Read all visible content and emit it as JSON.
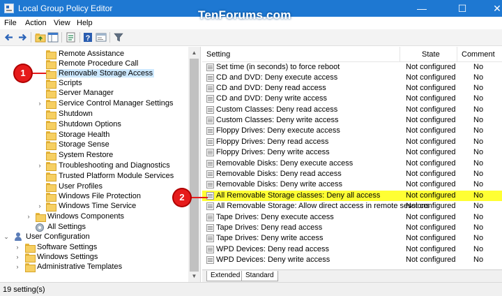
{
  "window": {
    "title": "Local Group Policy Editor",
    "watermark": "TenForums.com",
    "min_glyph": "—",
    "max_glyph": "☐",
    "close_glyph": "✕"
  },
  "menu": [
    "File",
    "Action",
    "View",
    "Help"
  ],
  "toolbar": {
    "icons": [
      "back-icon",
      "forward-icon",
      "up-folder-icon",
      "show-hide-tree-icon",
      "export-list-icon",
      "help-icon",
      "properties-icon",
      "filter-icon"
    ]
  },
  "tree": {
    "items": [
      {
        "label": "Remote Assistance",
        "expander": ""
      },
      {
        "label": "Remote Procedure Call",
        "expander": ""
      },
      {
        "label": "Removable Storage Access",
        "expander": "",
        "selected": true
      },
      {
        "label": "Scripts",
        "expander": ""
      },
      {
        "label": "Server Manager",
        "expander": ""
      },
      {
        "label": "Service Control Manager Settings",
        "expander": "›"
      },
      {
        "label": "Shutdown",
        "expander": ""
      },
      {
        "label": "Shutdown Options",
        "expander": ""
      },
      {
        "label": "Storage Health",
        "expander": ""
      },
      {
        "label": "Storage Sense",
        "expander": ""
      },
      {
        "label": "System Restore",
        "expander": ""
      },
      {
        "label": "Troubleshooting and Diagnostics",
        "expander": "›"
      },
      {
        "label": "Trusted Platform Module Services",
        "expander": ""
      },
      {
        "label": "User Profiles",
        "expander": ""
      },
      {
        "label": "Windows File Protection",
        "expander": ""
      },
      {
        "label": "Windows Time Service",
        "expander": "›"
      },
      {
        "label": "Windows Components",
        "expander": "›"
      },
      {
        "label": "All Settings",
        "expander": ""
      },
      {
        "label": "User Configuration",
        "expander": "⌄"
      },
      {
        "label": "Software Settings",
        "expander": "›"
      },
      {
        "label": "Windows Settings",
        "expander": "›"
      },
      {
        "label": "Administrative Templates",
        "expander": "›"
      }
    ]
  },
  "list": {
    "columns": {
      "setting": "Setting",
      "state": "State",
      "comment": "Comment"
    },
    "rows": [
      {
        "setting": "Set time (in seconds) to force reboot",
        "state": "Not configured",
        "comment": "No"
      },
      {
        "setting": "CD and DVD: Deny execute access",
        "state": "Not configured",
        "comment": "No"
      },
      {
        "setting": "CD and DVD: Deny read access",
        "state": "Not configured",
        "comment": "No"
      },
      {
        "setting": "CD and DVD: Deny write access",
        "state": "Not configured",
        "comment": "No"
      },
      {
        "setting": "Custom Classes: Deny read access",
        "state": "Not configured",
        "comment": "No"
      },
      {
        "setting": "Custom Classes: Deny write access",
        "state": "Not configured",
        "comment": "No"
      },
      {
        "setting": "Floppy Drives: Deny execute access",
        "state": "Not configured",
        "comment": "No"
      },
      {
        "setting": "Floppy Drives: Deny read access",
        "state": "Not configured",
        "comment": "No"
      },
      {
        "setting": "Floppy Drives: Deny write access",
        "state": "Not configured",
        "comment": "No"
      },
      {
        "setting": "Removable Disks: Deny execute access",
        "state": "Not configured",
        "comment": "No"
      },
      {
        "setting": "Removable Disks: Deny read access",
        "state": "Not configured",
        "comment": "No"
      },
      {
        "setting": "Removable Disks: Deny write access",
        "state": "Not configured",
        "comment": "No"
      },
      {
        "setting": "All Removable Storage classes: Deny all access",
        "state": "Not configured",
        "comment": "No",
        "highlight": true
      },
      {
        "setting": "All Removable Storage: Allow direct access in remote sessions",
        "state": "Not configured",
        "comment": "No"
      },
      {
        "setting": "Tape Drives: Deny execute access",
        "state": "Not configured",
        "comment": "No"
      },
      {
        "setting": "Tape Drives: Deny read access",
        "state": "Not configured",
        "comment": "No"
      },
      {
        "setting": "Tape Drives: Deny write access",
        "state": "Not configured",
        "comment": "No"
      },
      {
        "setting": "WPD Devices: Deny read access",
        "state": "Not configured",
        "comment": "No"
      },
      {
        "setting": "WPD Devices: Deny write access",
        "state": "Not configured",
        "comment": "No"
      }
    ]
  },
  "tabs": [
    "Extended",
    "Standard"
  ],
  "status": "19 setting(s)",
  "callouts": [
    "1",
    "2"
  ],
  "colors": {
    "title_bar": "#1e78d2",
    "highlight": "#ffff33",
    "callout": "#e61b1b",
    "selection": "#cce8ff"
  }
}
